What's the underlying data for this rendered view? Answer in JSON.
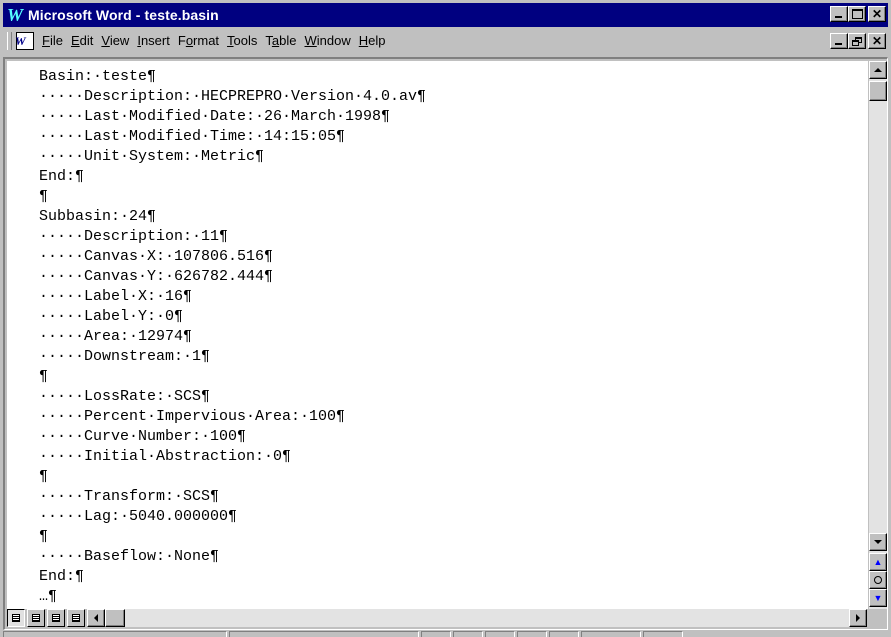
{
  "window": {
    "title": "Microsoft Word - teste.basin",
    "app_icon_letter": "W"
  },
  "menu": {
    "items": [
      {
        "label": "File",
        "accel": "F"
      },
      {
        "label": "Edit",
        "accel": "E"
      },
      {
        "label": "View",
        "accel": "V"
      },
      {
        "label": "Insert",
        "accel": "I"
      },
      {
        "label": "Format",
        "accel": "o"
      },
      {
        "label": "Tools",
        "accel": "T"
      },
      {
        "label": "Table",
        "accel": "a"
      },
      {
        "label": "Window",
        "accel": "W"
      },
      {
        "label": "Help",
        "accel": "H"
      }
    ]
  },
  "document": {
    "lines": [
      "Basin:·teste¶",
      "·····Description:·HECPREPRO·Version·4.0.av¶",
      "·····Last·Modified·Date:·26·March·1998¶",
      "·····Last·Modified·Time:·14:15:05¶",
      "·····Unit·System:·Metric¶",
      "End:¶",
      "¶",
      "Subbasin:·24¶",
      "·····Description:·11¶",
      "·····Canvas·X:·107806.516¶",
      "·····Canvas·Y:·626782.444¶",
      "·····Label·X:·16¶",
      "·····Label·Y:·0¶",
      "·····Area:·12974¶",
      "·····Downstream:·1¶",
      "¶",
      "·····LossRate:·SCS¶",
      "·····Percent·Impervious·Area:·100¶",
      "·····Curve·Number:·100¶",
      "·····Initial·Abstraction:·0¶",
      "¶",
      "·····Transform:·SCS¶",
      "·····Lag:·5040.000000¶",
      "¶",
      "·····Baseflow:·None¶",
      "End:¶",
      "…¶"
    ]
  },
  "colors": {
    "titlebar": "#000080",
    "face": "#c0c0c0",
    "page": "#ffffff"
  },
  "icons": {
    "app": "word-w-icon",
    "doc": "word-document-icon"
  }
}
